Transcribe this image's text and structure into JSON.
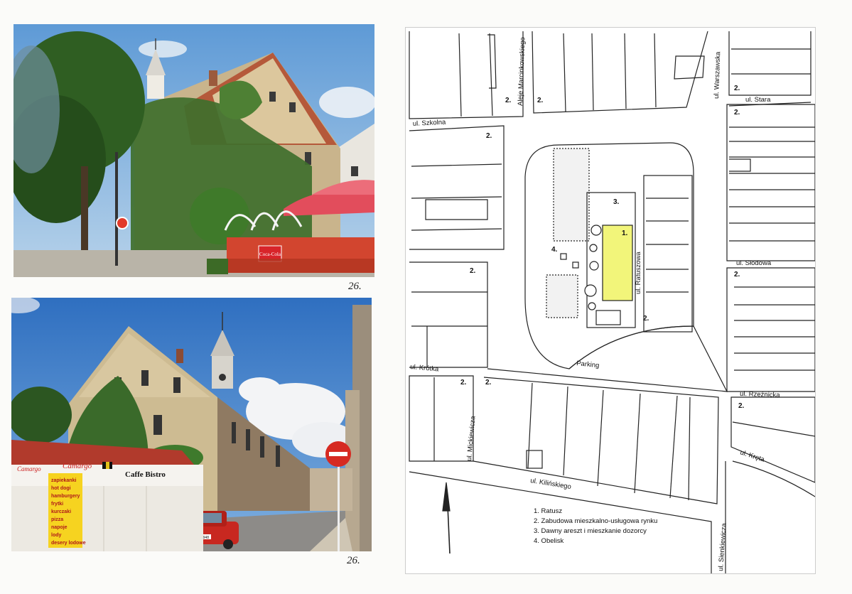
{
  "photos": {
    "top_caption": "26.",
    "bottom_caption": "26.",
    "kiosk_brand": "Camargo",
    "kiosk_sign": "Caffe  Bistro",
    "kiosk_menu": [
      "zapiekanki",
      "hot dogi",
      "hamburgery",
      "frytki",
      "kurczaki",
      "pizza",
      "napoje",
      "lody",
      "desery lodowe"
    ],
    "umbrella_brand": "Coca-Cola",
    "car_plate": "KZA 0948"
  },
  "map": {
    "streets": {
      "marcinkowskiego": "Aleje Marcinkowskiego",
      "warszawska": "ul. Warszawska",
      "szkolna": "ul. Szkolna",
      "stara": "ul. Stara",
      "slodowa": "ul. Słodowa",
      "ratuszowa": "ul. Ratuszowa",
      "krotka": "ul. Krótka",
      "rzeznicka": "ul. Rzeźnicka",
      "mickiewicza": "ul. Mickiewicza",
      "krela": "ul. Kręta",
      "kilinskiego": "ul. Kilińskiego",
      "sienkiewicza": "ul. Sienkiewicza"
    },
    "parking": "Parking",
    "labels": {
      "one": "1.",
      "two": "2.",
      "three": "3.",
      "four": "4."
    },
    "legend": [
      "1. Ratusz",
      "2. Zabudowa mieszkalno-usługowa rynku",
      "3. Dawny areszt i mieszkanie dozorcy",
      "4. Obelisk"
    ],
    "highlight_color": "#f2f57a"
  }
}
